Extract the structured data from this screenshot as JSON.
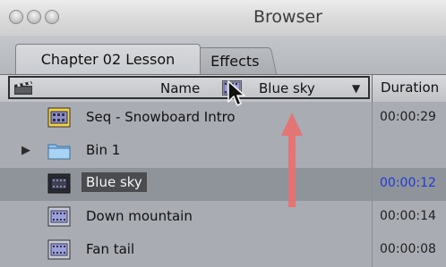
{
  "window": {
    "title": "Browser"
  },
  "tabs": [
    {
      "label": "Chapter 02 Lesson",
      "active": true
    },
    {
      "label": "Effects",
      "active": false
    }
  ],
  "header": {
    "name_label": "Name",
    "selected_value": "Blue sky",
    "duration_label": "Duration"
  },
  "rows": [
    {
      "label": "Seq - Snowboard Intro",
      "icon": "sequence-icon",
      "duration": "00:00:29"
    },
    {
      "label": "Bin 1",
      "icon": "folder-icon",
      "duration": ""
    },
    {
      "label": "Blue sky",
      "icon": "clip-icon",
      "duration": "00:00:12",
      "selected": true
    },
    {
      "label": "Down mountain",
      "icon": "clip-icon",
      "duration": "00:00:14"
    },
    {
      "label": "Fan tail",
      "icon": "clip-icon",
      "duration": "00:00:08"
    }
  ],
  "colors": {
    "annotation_arrow": "#e8706f",
    "selected_duration": "#1d3bd6"
  }
}
